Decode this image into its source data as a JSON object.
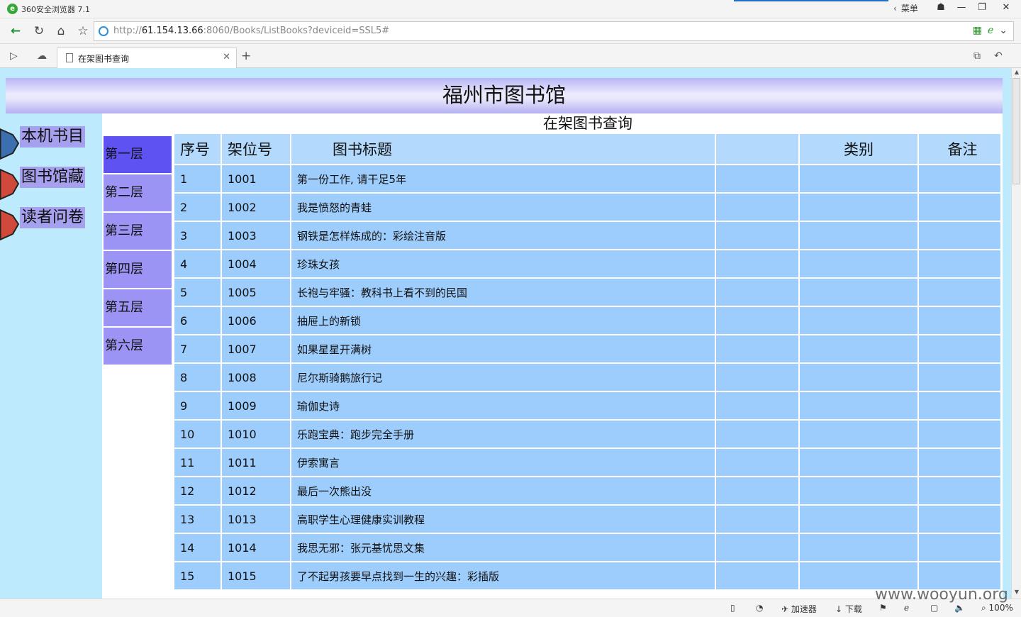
{
  "browser": {
    "app_title": "360安全浏览器 7.1",
    "menu_label": "菜单",
    "url_prefix": "http://",
    "url_host": "61.154.13.66",
    "url_rest": ":8060/Books/ListBooks?deviceid=SSL5#",
    "tab_title": "在架图书查询"
  },
  "page": {
    "site_title": "福州市图书馆",
    "heading": "在架图书查询"
  },
  "side_menu": [
    {
      "label": "本机书目",
      "color": "#3b6fb0"
    },
    {
      "label": "图书馆藏",
      "color": "#d04a3c"
    },
    {
      "label": "读者问卷",
      "color": "#d04a3c"
    }
  ],
  "floors": [
    "第一层",
    "第二层",
    "第三层",
    "第四层",
    "第五层",
    "第六层"
  ],
  "table": {
    "headers": [
      "序号",
      "架位号",
      "图书标题",
      "",
      "类别",
      "备注"
    ],
    "rows": [
      [
        "1",
        "1001",
        "第一份工作, 请干足5年"
      ],
      [
        "2",
        "1002",
        "我是愤怒的青蛙"
      ],
      [
        "3",
        "1003",
        "钢铁是怎样炼成的：彩绘注音版"
      ],
      [
        "4",
        "1004",
        "珍珠女孩"
      ],
      [
        "5",
        "1005",
        "长袍与牢骚：教科书上看不到的民国"
      ],
      [
        "6",
        "1006",
        "抽屉上的新锁"
      ],
      [
        "7",
        "1007",
        "如果星星开满树"
      ],
      [
        "8",
        "1008",
        "尼尔斯骑鹅旅行记"
      ],
      [
        "9",
        "1009",
        "瑜伽史诗"
      ],
      [
        "10",
        "1010",
        "乐跑宝典：跑步完全手册"
      ],
      [
        "11",
        "1011",
        "伊索寓言"
      ],
      [
        "12",
        "1012",
        "最后一次熊出没"
      ],
      [
        "13",
        "1013",
        "高职学生心理健康实训教程"
      ],
      [
        "14",
        "1014",
        "我思无邪：张元基忧思文集"
      ],
      [
        "15",
        "1015",
        "了不起男孩要早点找到一生的兴趣：彩插版"
      ]
    ]
  },
  "statusbar": {
    "accelerator": "加速器",
    "download": "下载",
    "zoom": "100%"
  },
  "watermark": "www.wooyun.org",
  "colors": {
    "page_bg": "#bdeafc",
    "active_floor": "#5e52f2",
    "floor": "#9b94f4",
    "header_cell": "#b3d9fc",
    "row_cell": "#9dcdfc"
  }
}
